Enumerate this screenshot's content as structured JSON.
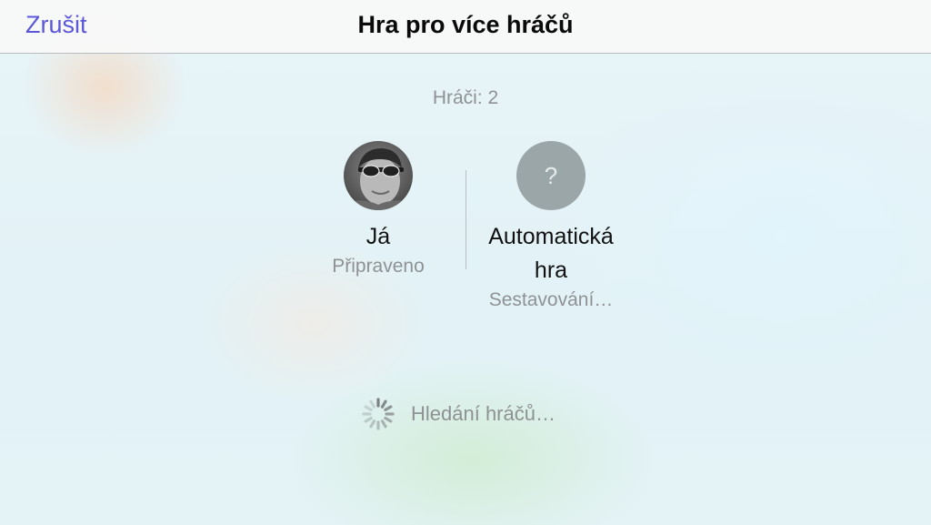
{
  "nav": {
    "cancel_label": "Zrušit",
    "title": "Hra pro více hráčů"
  },
  "players_count": "Hráči: 2",
  "players": [
    {
      "name": "Já",
      "status": "Připraveno",
      "avatar": "user-photo"
    },
    {
      "name": "Automatická hra",
      "status": "Sestavování…",
      "avatar_glyph": "?"
    }
  ],
  "searching": {
    "text": "Hledání hráčů…",
    "icon": "spinner-icon"
  },
  "colors": {
    "accent": "#5b57d9",
    "secondary_text": "#8f9294",
    "placeholder_avatar": "#9ba6a8"
  }
}
